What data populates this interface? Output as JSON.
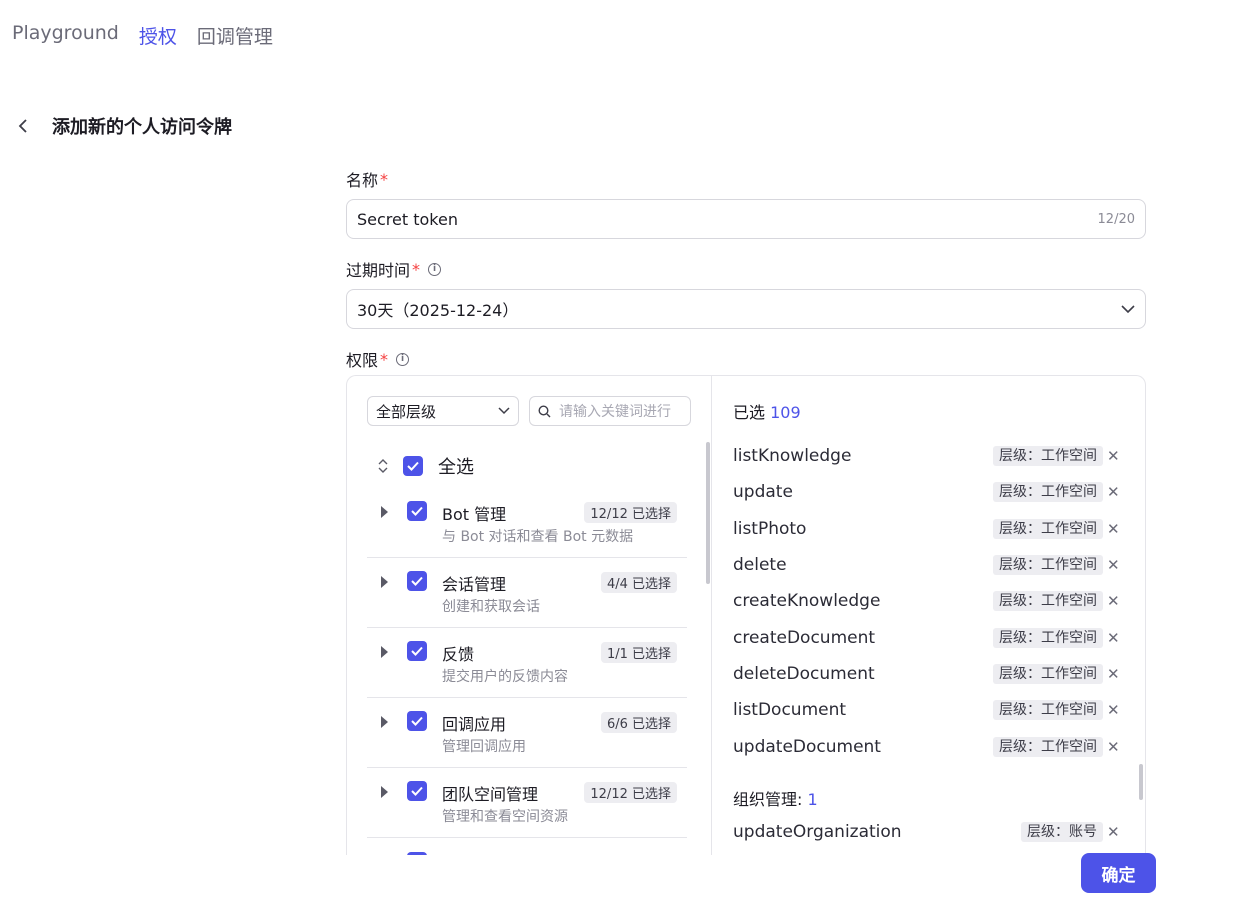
{
  "nav": {
    "tabs": [
      {
        "label": "Playground"
      },
      {
        "label": "授权"
      },
      {
        "label": "回调管理"
      }
    ]
  },
  "header": {
    "title": "添加新的个人访问令牌"
  },
  "form": {
    "name_label": "名称",
    "name_value": "Secret token",
    "name_counter": "12/20",
    "expire_label": "过期时间",
    "expire_value": "30天（2025-12-24）",
    "perm_label": "权限",
    "required_mark": "*"
  },
  "permissions": {
    "level_filter": "全部层级",
    "search_placeholder": "请输入关键词进行",
    "select_all_label": "全选",
    "groups": [
      {
        "title": "Bot 管理",
        "desc": "与 Bot 对话和查看 Bot 元数据",
        "badge": "12/12 已选择"
      },
      {
        "title": "会话管理",
        "desc": "创建和获取会话",
        "badge": "4/4 已选择"
      },
      {
        "title": "反馈",
        "desc": "提交用户的反馈内容",
        "badge": "1/1 已选择"
      },
      {
        "title": "回调应用",
        "desc": "管理回调应用",
        "badge": "6/6 已选择"
      },
      {
        "title": "团队空间管理",
        "desc": "管理和查看空间资源",
        "badge": "12/12 已选择"
      }
    ],
    "selected_label": "已选",
    "selected_count": "109",
    "selected_items": [
      {
        "name": "listKnowledge",
        "tag": "层级：工作空间"
      },
      {
        "name": "update",
        "tag": "层级：工作空间"
      },
      {
        "name": "listPhoto",
        "tag": "层级：工作空间"
      },
      {
        "name": "delete",
        "tag": "层级：工作空间"
      },
      {
        "name": "createKnowledge",
        "tag": "层级：工作空间"
      },
      {
        "name": "createDocument",
        "tag": "层级：工作空间"
      },
      {
        "name": "deleteDocument",
        "tag": "层级：工作空间"
      },
      {
        "name": "listDocument",
        "tag": "层级：工作空间"
      },
      {
        "name": "updateDocument",
        "tag": "层级：工作空间"
      }
    ],
    "org_section_label": "组织管理:",
    "org_section_count": "1",
    "org_items": [
      {
        "name": "updateOrganization",
        "tag": "层级：账号"
      }
    ]
  },
  "footer": {
    "confirm_label": "确定"
  },
  "colors": {
    "accent": "#4d53e8",
    "required": "#f53f3f"
  }
}
